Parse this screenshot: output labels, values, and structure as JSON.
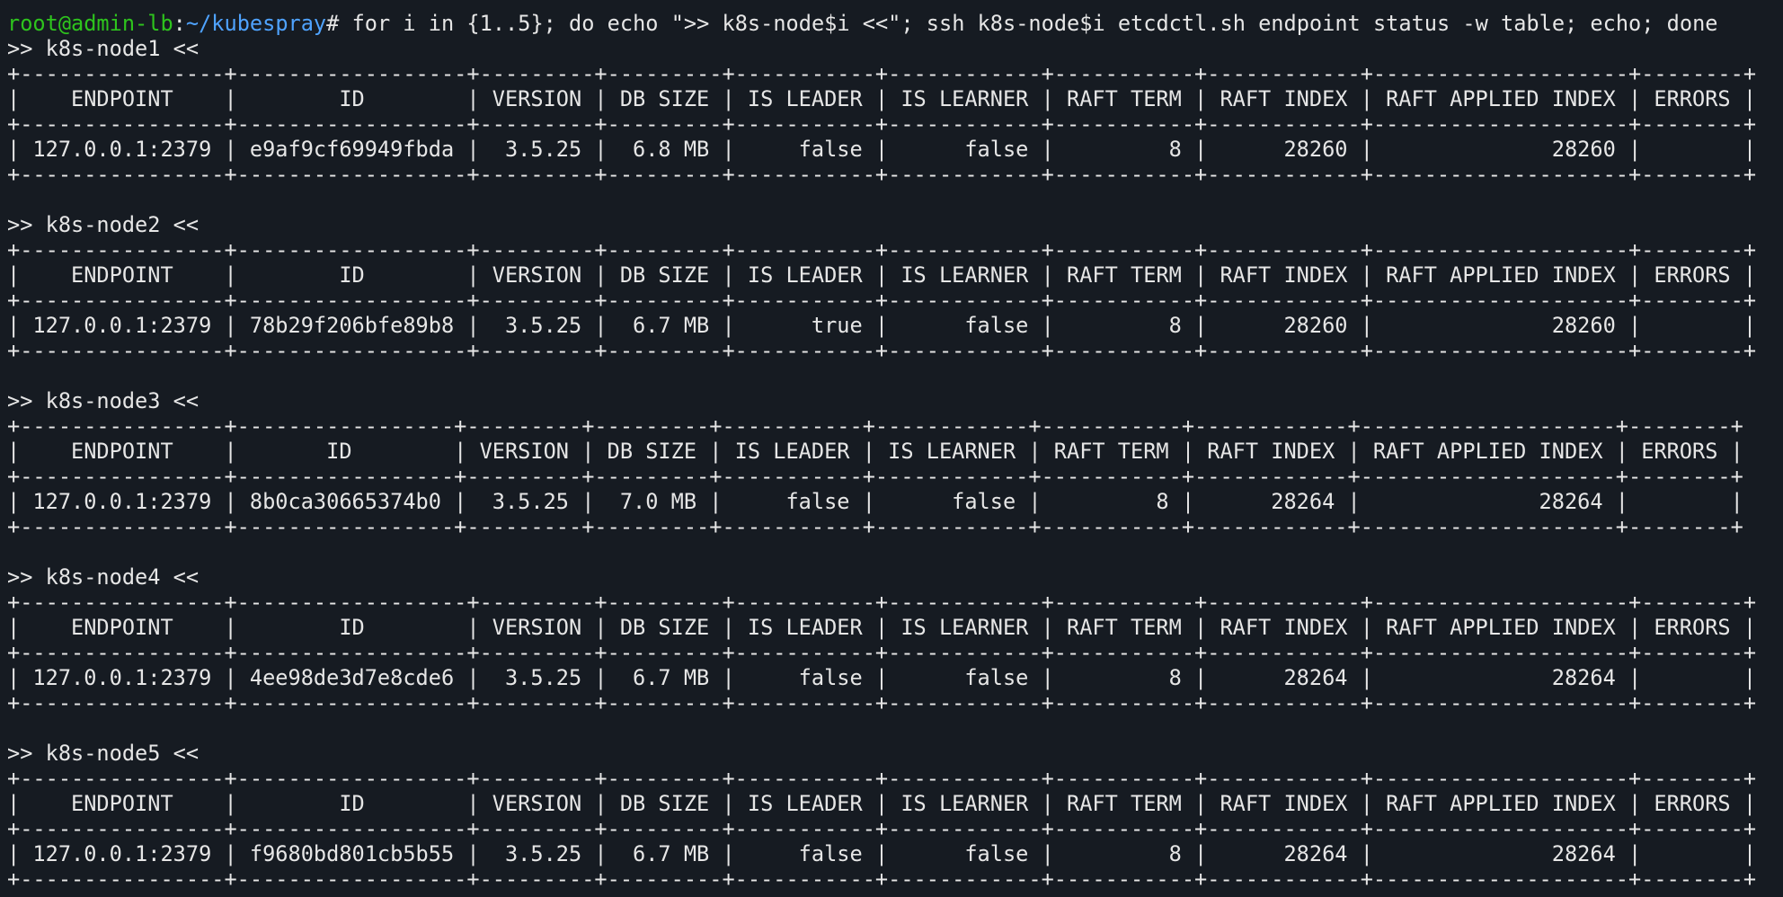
{
  "terminal": {
    "prompt_user": "root@admin-lb",
    "prompt_sep": ":",
    "prompt_path": "~/kubespray",
    "prompt_symbol": "# ",
    "command": "for i in {1..5}; do echo \">> k8s-node$i <<\"; ssh k8s-node$i etcdctl.sh endpoint status -w table; echo; done",
    "colors": {
      "background": "#161b22",
      "text": "#e6e6e6",
      "prompt_user": "#2ec41d",
      "prompt_path": "#4fa3ff"
    }
  },
  "tables": [
    {
      "node_line": ">> k8s-node1 <<",
      "lines": [
        "+----------------+------------------+---------+---------+-----------+------------+-----------+------------+--------------------+--------+",
        "|    ENDPOINT    |        ID        | VERSION | DB SIZE | IS LEADER | IS LEARNER | RAFT TERM | RAFT INDEX | RAFT APPLIED INDEX | ERRORS |",
        "+----------------+------------------+---------+---------+-----------+------------+-----------+------------+--------------------+--------+",
        "| 127.0.0.1:2379 | e9af9cf69949fbda |  3.5.25 |  6.8 MB |     false |      false |         8 |      28260 |              28260 |        |",
        "+----------------+------------------+---------+---------+-----------+------------+-----------+------------+--------------------+--------+"
      ]
    },
    {
      "node_line": ">> k8s-node2 <<",
      "lines": [
        "+----------------+------------------+---------+---------+-----------+------------+-----------+------------+--------------------+--------+",
        "|    ENDPOINT    |        ID        | VERSION | DB SIZE | IS LEADER | IS LEARNER | RAFT TERM | RAFT INDEX | RAFT APPLIED INDEX | ERRORS |",
        "+----------------+------------------+---------+---------+-----------+------------+-----------+------------+--------------------+--------+",
        "| 127.0.0.1:2379 | 78b29f206bfe89b8 |  3.5.25 |  6.7 MB |      true |      false |         8 |      28260 |              28260 |        |",
        "+----------------+------------------+---------+---------+-----------+------------+-----------+------------+--------------------+--------+"
      ]
    },
    {
      "node_line": ">> k8s-node3 <<",
      "lines": [
        "+----------------+-----------------+---------+---------+-----------+------------+-----------+------------+--------------------+--------+",
        "|    ENDPOINT    |       ID        | VERSION | DB SIZE | IS LEADER | IS LEARNER | RAFT TERM | RAFT INDEX | RAFT APPLIED INDEX | ERRORS |",
        "+----------------+-----------------+---------+---------+-----------+------------+-----------+------------+--------------------+--------+",
        "| 127.0.0.1:2379 | 8b0ca30665374b0 |  3.5.25 |  7.0 MB |     false |      false |         8 |      28264 |              28264 |        |",
        "+----------------+-----------------+---------+---------+-----------+------------+-----------+------------+--------------------+--------+"
      ]
    },
    {
      "node_line": ">> k8s-node4 <<",
      "lines": [
        "+----------------+------------------+---------+---------+-----------+------------+-----------+------------+--------------------+--------+",
        "|    ENDPOINT    |        ID        | VERSION | DB SIZE | IS LEADER | IS LEARNER | RAFT TERM | RAFT INDEX | RAFT APPLIED INDEX | ERRORS |",
        "+----------------+------------------+---------+---------+-----------+------------+-----------+------------+--------------------+--------+",
        "| 127.0.0.1:2379 | 4ee98de3d7e8cde6 |  3.5.25 |  6.7 MB |     false |      false |         8 |      28264 |              28264 |        |",
        "+----------------+------------------+---------+---------+-----------+------------+-----------+------------+--------------------+--------+"
      ]
    },
    {
      "node_line": ">> k8s-node5 <<",
      "lines": [
        "+----------------+------------------+---------+---------+-----------+------------+-----------+------------+--------------------+--------+",
        "|    ENDPOINT    |        ID        | VERSION | DB SIZE | IS LEADER | IS LEARNER | RAFT TERM | RAFT INDEX | RAFT APPLIED INDEX | ERRORS |",
        "+----------------+------------------+---------+---------+-----------+------------+-----------+------------+--------------------+--------+",
        "| 127.0.0.1:2379 | f9680bd801cb5b55 |  3.5.25 |  6.7 MB |     false |      false |         8 |      28264 |              28264 |        |",
        "+----------------+------------------+---------+---------+-----------+------------+-----------+------------+--------------------+--------+"
      ]
    }
  ]
}
